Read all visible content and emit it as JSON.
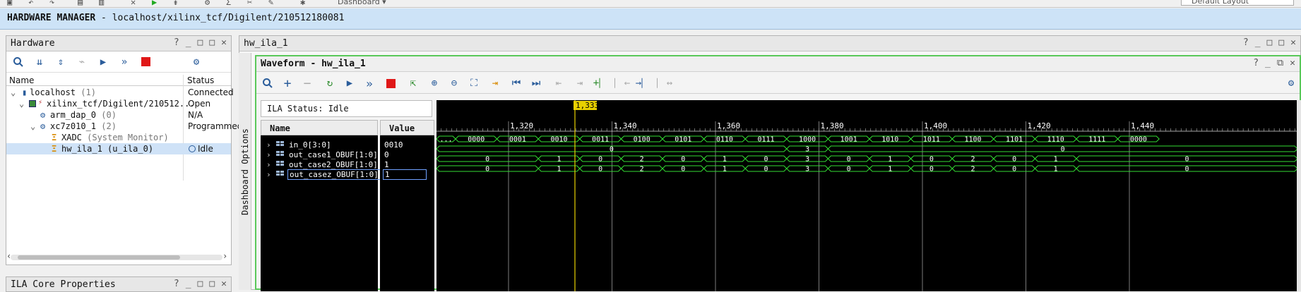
{
  "top_toolbar": {
    "dashboard_label": "Dashboard ▾",
    "layout_label": "Default Layout"
  },
  "hardware_manager": {
    "prefix": "HARDWARE MANAGER",
    "path": " - localhost/xilinx_tcf/Digilent/210512180081"
  },
  "hardware_panel": {
    "title": "Hardware",
    "col_name": "Name",
    "col_status": "Status",
    "rows": [
      {
        "label": "localhost",
        "extra": " (1)",
        "status": "Connected"
      },
      {
        "label": "xilinx_tcf/Digilent/210512...",
        "extra": "",
        "status": "Open"
      },
      {
        "label": "arm_dap_0",
        "extra": " (0)",
        "status": "N/A"
      },
      {
        "label": "xc7z010_1",
        "extra": " (2)",
        "status": "Programmed"
      },
      {
        "label": "XADC",
        "extra": " (System Monitor)",
        "status": ""
      },
      {
        "label": "hw_ila_1 (u_ila_0)",
        "extra": "",
        "status": "Idle"
      }
    ]
  },
  "ila_core_props": {
    "title": "ILA Core Properties"
  },
  "tab_panel": {
    "title": "hw_ila_1"
  },
  "dashboard_options": "Dashboard Options",
  "waveform": {
    "title": "Waveform - hw_ila_1",
    "ila_status": "ILA Status: Idle",
    "col_name": "Name",
    "col_value": "Value",
    "cursor_label": "1,333",
    "time_labels": [
      "1,320",
      "1,340",
      "1,360",
      "1,380",
      "1,400",
      "1,420",
      "1,440"
    ],
    "signals": [
      {
        "name": "in_0[3:0]",
        "value": "0010",
        "segments": [
          "...",
          "0000",
          "0001",
          "0010",
          "0011",
          "0100",
          "0101",
          "0110",
          "0111",
          "1000",
          "1001",
          "1010",
          "1011",
          "1100",
          "1101",
          "1110",
          "1111",
          "0000"
        ]
      },
      {
        "name": "out_case1_OBUF[1:0]",
        "value": "0",
        "segments": [
          "0",
          "3",
          "0"
        ]
      },
      {
        "name": "out_case2_OBUF[1:0]",
        "value": "1",
        "segments": [
          "0",
          "1",
          "0",
          "2",
          "0",
          "1",
          "0",
          "3",
          "0",
          "1",
          "0",
          "2",
          "0",
          "1",
          "0"
        ]
      },
      {
        "name": "out_casez_OBUF[1:0]",
        "value": "1",
        "segments": [
          "0",
          "1",
          "0",
          "2",
          "0",
          "1",
          "0",
          "3",
          "0",
          "1",
          "0",
          "2",
          "0",
          "1",
          "0"
        ]
      }
    ]
  },
  "colors": {
    "wave_green": "#33dd33",
    "cursor": "#e8d000",
    "frame_green": "#5ac85a",
    "stop_red": "#e01818"
  }
}
